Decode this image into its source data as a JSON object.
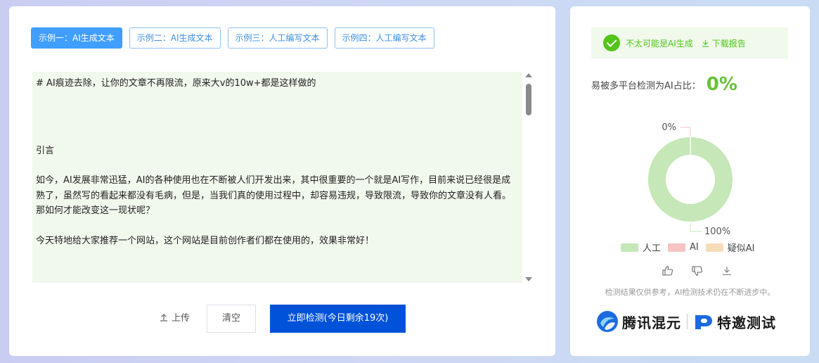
{
  "tabs": [
    {
      "label": "示例一：AI生成文本",
      "active": true
    },
    {
      "label": "示例二：AI生成文本",
      "active": false
    },
    {
      "label": "示例三：人工编写文本",
      "active": false
    },
    {
      "label": "示例四：人工编写文本",
      "active": false
    }
  ],
  "editor": {
    "title": "# AI痕迹去除，让你的文章不再限流，原来大v的10w+都是这样做的",
    "intro": "引言",
    "para1": "如今，AI发展非常迅猛，AI的各种使用也在不断被人们开发出来，其中很重要的一个就是AI写作，目前来说已经很是成熟了，虽然写的看起来都没有毛病，但是，当我们真的使用过程中，却容易违规，导致限流，导致你的文章没有人看。那如何才能改变这一现状呢？",
    "para2": "今天特地给大家推荐一个网站，这个网站是目前创作者们都在使用的，效果非常好！"
  },
  "actions": {
    "upload_label": "上传",
    "clear_label": "清空",
    "detect_label": "立即检测(今日剩余19次)"
  },
  "result": {
    "verdict": "不太可能是AI生成",
    "download_label": "下载报告",
    "ratio_label": "易被多平台检测为AI占比：",
    "ratio_value": "0%"
  },
  "chart_data": {
    "type": "pie",
    "categories": [
      "人工",
      "AI",
      "疑似AI"
    ],
    "values": [
      100,
      0,
      0
    ],
    "labels": [
      "100%",
      "0%"
    ],
    "colors": [
      "#c6e7b7",
      "#f7c3c3",
      "#f6ddb8"
    ],
    "legend": "bottom"
  },
  "disclaimer": "检测结果仅供参考，AI检测技术仍在不断进步中。",
  "brand": {
    "name1": "腾讯混元",
    "name2": "特邀测试"
  }
}
